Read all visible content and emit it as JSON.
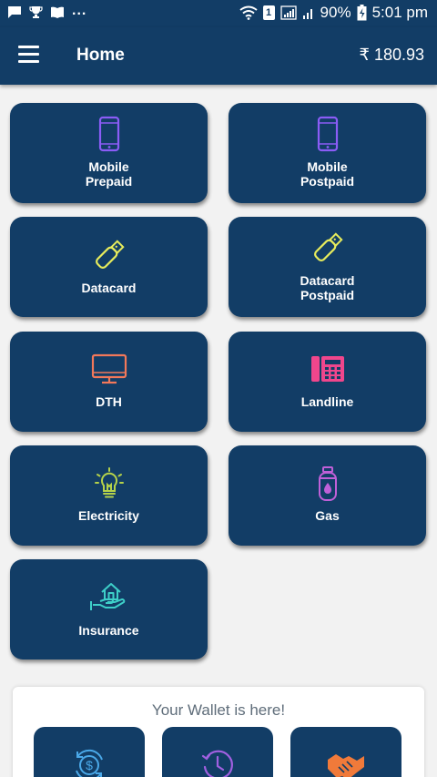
{
  "status_bar": {
    "battery": "90%",
    "time": "5:01 pm",
    "overflow": "...",
    "sim_number": "1"
  },
  "app_bar": {
    "title": "Home",
    "balance": "₹ 180.93",
    "menu_icon": "hamburger-menu-icon"
  },
  "services": [
    {
      "label": "Mobile\nPrepaid",
      "icon": "mobile-icon",
      "color": "#8b5cf6"
    },
    {
      "label": "Mobile\nPostpaid",
      "icon": "mobile-icon",
      "color": "#8b5cf6"
    },
    {
      "label": "Datacard",
      "icon": "usb-datacard-icon",
      "color": "#e7ec5c"
    },
    {
      "label": "Datacard\nPostpaid",
      "icon": "usb-datacard-icon",
      "color": "#e7ec5c"
    },
    {
      "label": "DTH",
      "icon": "tv-monitor-icon",
      "color": "#f2785a"
    },
    {
      "label": "Landline",
      "icon": "telephone-icon",
      "color": "#f0468c"
    },
    {
      "label": "Electricity",
      "icon": "lightbulb-icon",
      "color": "#b5d24a"
    },
    {
      "label": "Gas",
      "icon": "gas-cylinder-icon",
      "color": "#c060d8"
    },
    {
      "label": "Insurance",
      "icon": "house-in-hand-icon",
      "color": "#3ed0c9"
    }
  ],
  "wallet": {
    "title": "Your Wallet is here!",
    "items": [
      {
        "icon": "dollar-cycle-icon",
        "color": "#4aa8e8"
      },
      {
        "icon": "history-clock-icon",
        "color": "#a060e0"
      },
      {
        "icon": "handshake-icon",
        "color": "#f07a3a"
      }
    ]
  }
}
